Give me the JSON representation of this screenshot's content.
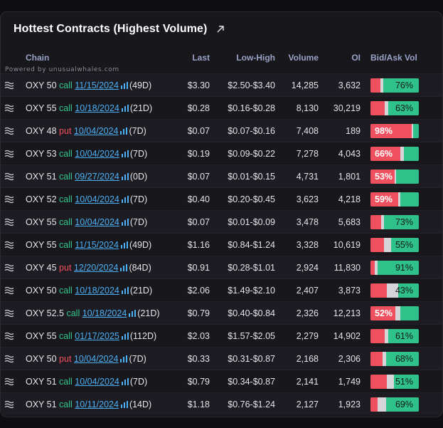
{
  "title": "Hottest Contracts (Highest Volume)",
  "powered_by": "Powered by unusualwhales.com",
  "columns": {
    "chain": "Chain",
    "last": "Last",
    "low_high": "Low-High",
    "volume": "Volume",
    "oi": "OI",
    "bid_ask": "Bid/Ask Vol"
  },
  "colors": {
    "call": "#33c58a",
    "put": "#f0505d",
    "link": "#4db0f5",
    "bid": "#ef5060",
    "ask": "#2ec28a",
    "mid": "#d5d5d9"
  },
  "rows": [
    {
      "sym": "OXY 50",
      "type": "call",
      "exp": "11/15/2024",
      "dte": "(49D)",
      "last": "$3.30",
      "lowhigh": "$2.50-$3.40",
      "volume": "14,285",
      "oi": "3,632",
      "pct": "76%",
      "side": "ask",
      "bid_frac": 0.2,
      "mid_frac": 0.06
    },
    {
      "sym": "OXY 55",
      "type": "call",
      "exp": "10/18/2024",
      "dte": "(21D)",
      "last": "$0.28",
      "lowhigh": "$0.16-$0.28",
      "volume": "8,130",
      "oi": "30,219",
      "pct": "63%",
      "side": "ask",
      "bid_frac": 0.3,
      "mid_frac": 0.07
    },
    {
      "sym": "OXY 48",
      "type": "put",
      "exp": "10/04/2024",
      "dte": "(7D)",
      "last": "$0.07",
      "lowhigh": "$0.07-$0.16",
      "volume": "7,408",
      "oi": "189",
      "pct": "98%",
      "side": "bid",
      "bid_frac": 0.86,
      "mid_frac": 0.03
    },
    {
      "sym": "OXY 53",
      "type": "call",
      "exp": "10/04/2024",
      "dte": "(7D)",
      "last": "$0.19",
      "lowhigh": "$0.09-$0.22",
      "volume": "7,278",
      "oi": "4,043",
      "pct": "66%",
      "side": "bid",
      "bid_frac": 0.62,
      "mid_frac": 0.08
    },
    {
      "sym": "OXY 51",
      "type": "call",
      "exp": "09/27/2024",
      "dte": "(0D)",
      "last": "$0.07",
      "lowhigh": "$0.01-$0.15",
      "volume": "4,731",
      "oi": "1,801",
      "pct": "53%",
      "side": "bid",
      "bid_frac": 0.5,
      "mid_frac": 0.03
    },
    {
      "sym": "OXY 52",
      "type": "call",
      "exp": "10/04/2024",
      "dte": "(7D)",
      "last": "$0.40",
      "lowhigh": "$0.20-$0.45",
      "volume": "3,623",
      "oi": "4,218",
      "pct": "59%",
      "side": "bid",
      "bid_frac": 0.57,
      "mid_frac": 0.05
    },
    {
      "sym": "OXY 55",
      "type": "call",
      "exp": "10/04/2024",
      "dte": "(7D)",
      "last": "$0.07",
      "lowhigh": "$0.01-$0.09",
      "volume": "3,478",
      "oi": "5,683",
      "pct": "73%",
      "side": "ask",
      "bid_frac": 0.22,
      "mid_frac": 0.06
    },
    {
      "sym": "OXY 55",
      "type": "call",
      "exp": "11/15/2024",
      "dte": "(49D)",
      "last": "$1.16",
      "lowhigh": "$0.84-$1.24",
      "volume": "3,328",
      "oi": "10,619",
      "pct": "55%",
      "side": "ask",
      "bid_frac": 0.28,
      "mid_frac": 0.15
    },
    {
      "sym": "OXY 45",
      "type": "put",
      "exp": "12/20/2024",
      "dte": "(84D)",
      "last": "$0.91",
      "lowhigh": "$0.28-$1.01",
      "volume": "2,924",
      "oi": "11,830",
      "pct": "91%",
      "side": "ask",
      "bid_frac": 0.09,
      "mid_frac": 0.06
    },
    {
      "sym": "OXY 50",
      "type": "call",
      "exp": "10/18/2024",
      "dte": "(21D)",
      "last": "$2.06",
      "lowhigh": "$1.49-$2.10",
      "volume": "2,407",
      "oi": "3,873",
      "pct": "43%",
      "side": "ask",
      "bid_frac": 0.34,
      "mid_frac": 0.23
    },
    {
      "sym": "OXY 52.5",
      "type": "call",
      "exp": "10/18/2024",
      "dte": "(21D)",
      "last": "$0.79",
      "lowhigh": "$0.40-$0.84",
      "volume": "2,326",
      "oi": "12,213",
      "pct": "52%",
      "side": "bid",
      "bid_frac": 0.52,
      "mid_frac": 0.1
    },
    {
      "sym": "OXY 55",
      "type": "call",
      "exp": "01/17/2025",
      "dte": "(112D)",
      "last": "$2.03",
      "lowhigh": "$1.57-$2.05",
      "volume": "2,279",
      "oi": "14,902",
      "pct": "61%",
      "side": "ask",
      "bid_frac": 0.3,
      "mid_frac": 0.07
    },
    {
      "sym": "OXY 50",
      "type": "put",
      "exp": "10/04/2024",
      "dte": "(7D)",
      "last": "$0.33",
      "lowhigh": "$0.31-$0.87",
      "volume": "2,168",
      "oi": "2,306",
      "pct": "68%",
      "side": "ask",
      "bid_frac": 0.25,
      "mid_frac": 0.07
    },
    {
      "sym": "OXY 51",
      "type": "call",
      "exp": "10/04/2024",
      "dte": "(7D)",
      "last": "$0.79",
      "lowhigh": "$0.34-$0.87",
      "volume": "2,141",
      "oi": "1,749",
      "pct": "51%",
      "side": "ask",
      "bid_frac": 0.34,
      "mid_frac": 0.15
    },
    {
      "sym": "OXY 51",
      "type": "call",
      "exp": "10/11/2024",
      "dte": "(14D)",
      "last": "$1.18",
      "lowhigh": "$0.76-$1.24",
      "volume": "2,127",
      "oi": "1,923",
      "pct": "69%",
      "side": "ask",
      "bid_frac": 0.14,
      "mid_frac": 0.17
    }
  ]
}
